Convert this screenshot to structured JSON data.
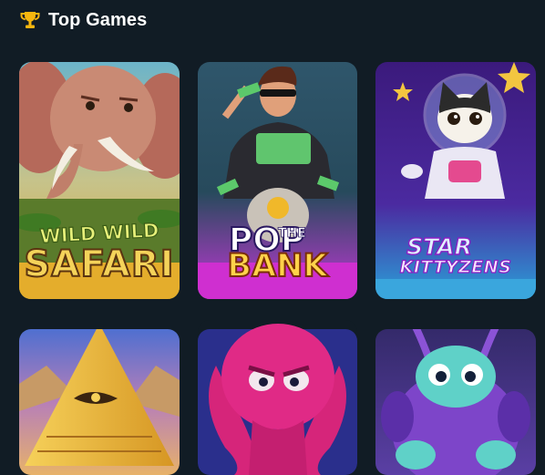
{
  "section": {
    "title": "Top Games",
    "icon": "trophy-icon",
    "accent": "#f5b50f"
  },
  "games": [
    {
      "name": "Wild Wild Safari",
      "logo_line1": "WILD WILD",
      "logo_line2": "SAFARI"
    },
    {
      "name": "Pop the Bank",
      "logo_line1": "POP",
      "logo_line1_small": "THE",
      "logo_line2": "BANK"
    },
    {
      "name": "Star Kittyzens",
      "logo_line1": "STAR",
      "logo_line2": "KITTYZENS"
    },
    {
      "name": "Pyramid game"
    },
    {
      "name": "Octopus game"
    },
    {
      "name": "Alien game"
    }
  ],
  "colors": {
    "background": "#111c25",
    "title_text": "#ffffff"
  }
}
